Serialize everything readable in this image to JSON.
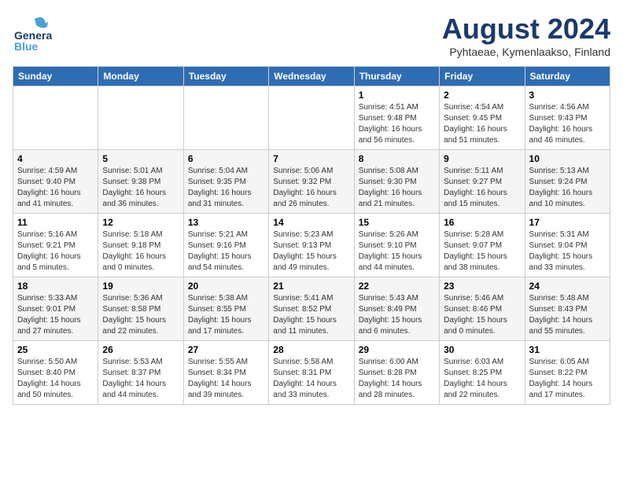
{
  "header": {
    "logo_general": "General",
    "logo_blue": "Blue",
    "month_year": "August 2024",
    "location": "Pyhtaeae, Kymenlaakso, Finland"
  },
  "weekdays": [
    "Sunday",
    "Monday",
    "Tuesday",
    "Wednesday",
    "Thursday",
    "Friday",
    "Saturday"
  ],
  "weeks": [
    [
      {
        "day": "",
        "info": ""
      },
      {
        "day": "",
        "info": ""
      },
      {
        "day": "",
        "info": ""
      },
      {
        "day": "",
        "info": ""
      },
      {
        "day": "1",
        "info": "Sunrise: 4:51 AM\nSunset: 9:48 PM\nDaylight: 16 hours\nand 56 minutes."
      },
      {
        "day": "2",
        "info": "Sunrise: 4:54 AM\nSunset: 9:45 PM\nDaylight: 16 hours\nand 51 minutes."
      },
      {
        "day": "3",
        "info": "Sunrise: 4:56 AM\nSunset: 9:43 PM\nDaylight: 16 hours\nand 46 minutes."
      }
    ],
    [
      {
        "day": "4",
        "info": "Sunrise: 4:59 AM\nSunset: 9:40 PM\nDaylight: 16 hours\nand 41 minutes."
      },
      {
        "day": "5",
        "info": "Sunrise: 5:01 AM\nSunset: 9:38 PM\nDaylight: 16 hours\nand 36 minutes."
      },
      {
        "day": "6",
        "info": "Sunrise: 5:04 AM\nSunset: 9:35 PM\nDaylight: 16 hours\nand 31 minutes."
      },
      {
        "day": "7",
        "info": "Sunrise: 5:06 AM\nSunset: 9:32 PM\nDaylight: 16 hours\nand 26 minutes."
      },
      {
        "day": "8",
        "info": "Sunrise: 5:08 AM\nSunset: 9:30 PM\nDaylight: 16 hours\nand 21 minutes."
      },
      {
        "day": "9",
        "info": "Sunrise: 5:11 AM\nSunset: 9:27 PM\nDaylight: 16 hours\nand 15 minutes."
      },
      {
        "day": "10",
        "info": "Sunrise: 5:13 AM\nSunset: 9:24 PM\nDaylight: 16 hours\nand 10 minutes."
      }
    ],
    [
      {
        "day": "11",
        "info": "Sunrise: 5:16 AM\nSunset: 9:21 PM\nDaylight: 16 hours\nand 5 minutes."
      },
      {
        "day": "12",
        "info": "Sunrise: 5:18 AM\nSunset: 9:18 PM\nDaylight: 16 hours\nand 0 minutes."
      },
      {
        "day": "13",
        "info": "Sunrise: 5:21 AM\nSunset: 9:16 PM\nDaylight: 15 hours\nand 54 minutes."
      },
      {
        "day": "14",
        "info": "Sunrise: 5:23 AM\nSunset: 9:13 PM\nDaylight: 15 hours\nand 49 minutes."
      },
      {
        "day": "15",
        "info": "Sunrise: 5:26 AM\nSunset: 9:10 PM\nDaylight: 15 hours\nand 44 minutes."
      },
      {
        "day": "16",
        "info": "Sunrise: 5:28 AM\nSunset: 9:07 PM\nDaylight: 15 hours\nand 38 minutes."
      },
      {
        "day": "17",
        "info": "Sunrise: 5:31 AM\nSunset: 9:04 PM\nDaylight: 15 hours\nand 33 minutes."
      }
    ],
    [
      {
        "day": "18",
        "info": "Sunrise: 5:33 AM\nSunset: 9:01 PM\nDaylight: 15 hours\nand 27 minutes."
      },
      {
        "day": "19",
        "info": "Sunrise: 5:36 AM\nSunset: 8:58 PM\nDaylight: 15 hours\nand 22 minutes."
      },
      {
        "day": "20",
        "info": "Sunrise: 5:38 AM\nSunset: 8:55 PM\nDaylight: 15 hours\nand 17 minutes."
      },
      {
        "day": "21",
        "info": "Sunrise: 5:41 AM\nSunset: 8:52 PM\nDaylight: 15 hours\nand 11 minutes."
      },
      {
        "day": "22",
        "info": "Sunrise: 5:43 AM\nSunset: 8:49 PM\nDaylight: 15 hours\nand 6 minutes."
      },
      {
        "day": "23",
        "info": "Sunrise: 5:46 AM\nSunset: 8:46 PM\nDaylight: 15 hours\nand 0 minutes."
      },
      {
        "day": "24",
        "info": "Sunrise: 5:48 AM\nSunset: 8:43 PM\nDaylight: 14 hours\nand 55 minutes."
      }
    ],
    [
      {
        "day": "25",
        "info": "Sunrise: 5:50 AM\nSunset: 8:40 PM\nDaylight: 14 hours\nand 50 minutes."
      },
      {
        "day": "26",
        "info": "Sunrise: 5:53 AM\nSunset: 8:37 PM\nDaylight: 14 hours\nand 44 minutes."
      },
      {
        "day": "27",
        "info": "Sunrise: 5:55 AM\nSunset: 8:34 PM\nDaylight: 14 hours\nand 39 minutes."
      },
      {
        "day": "28",
        "info": "Sunrise: 5:58 AM\nSunset: 8:31 PM\nDaylight: 14 hours\nand 33 minutes."
      },
      {
        "day": "29",
        "info": "Sunrise: 6:00 AM\nSunset: 8:28 PM\nDaylight: 14 hours\nand 28 minutes."
      },
      {
        "day": "30",
        "info": "Sunrise: 6:03 AM\nSunset: 8:25 PM\nDaylight: 14 hours\nand 22 minutes."
      },
      {
        "day": "31",
        "info": "Sunrise: 6:05 AM\nSunset: 8:22 PM\nDaylight: 14 hours\nand 17 minutes."
      }
    ]
  ]
}
